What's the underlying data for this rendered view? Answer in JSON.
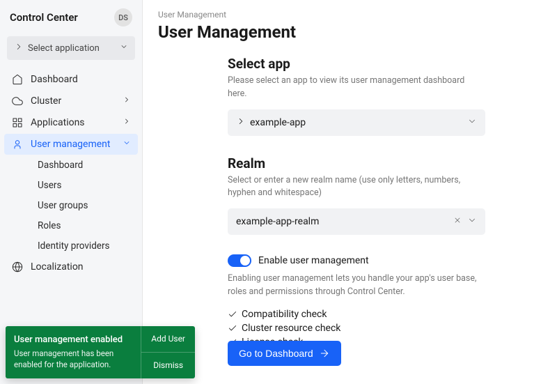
{
  "header": {
    "title": "Control Center",
    "avatar": "DS",
    "app_selector": "Select application"
  },
  "sidebar": {
    "items": [
      {
        "label": "Dashboard",
        "icon": "home"
      },
      {
        "label": "Cluster",
        "icon": "cloud",
        "chevron": true
      },
      {
        "label": "Applications",
        "icon": "apps",
        "chevron": true
      },
      {
        "label": "User management",
        "icon": "user",
        "chevron": true,
        "active": true
      },
      {
        "label": "Localization",
        "icon": "globe"
      }
    ],
    "sub_items": [
      {
        "label": "Dashboard"
      },
      {
        "label": "Users"
      },
      {
        "label": "User groups"
      },
      {
        "label": "Roles"
      },
      {
        "label": "Identity providers"
      }
    ]
  },
  "main": {
    "breadcrumb": "User Management",
    "title": "User Management",
    "select_app": {
      "heading": "Select app",
      "desc": "Please select an app to view its user management dashboard here.",
      "value": "example-app"
    },
    "realm": {
      "heading": "Realm",
      "desc": "Select or enter a new realm name (use only letters, numbers, hyphen and whitespace)",
      "value": "example-app-realm"
    },
    "enable": {
      "label": "Enable user management",
      "desc": "Enabling user management lets you handle your app's user base, roles and permissions through Control Center."
    },
    "checks": [
      "Compatibility check",
      "Cluster resource check",
      "License check"
    ],
    "go_btn": "Go to Dashboard"
  },
  "toast": {
    "title": "User management enabled",
    "msg": "User management has been enabled for the application.",
    "add": "Add User",
    "dismiss": "Dismiss"
  }
}
